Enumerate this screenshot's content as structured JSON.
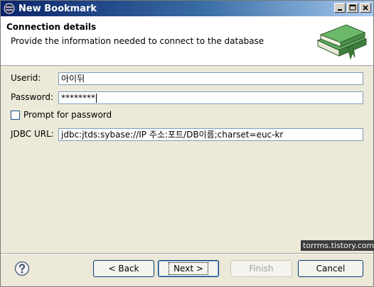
{
  "window": {
    "title": "New Bookmark"
  },
  "banner": {
    "title": "Connection details",
    "description": "Provide the information needed to connect to the database"
  },
  "form": {
    "userid_label": "Userid:",
    "userid_value": "아이뒤",
    "password_label": "Password:",
    "password_value": "********",
    "prompt_label": "Prompt for password",
    "prompt_checked": false,
    "jdbc_label": "JDBC URL:",
    "jdbc_value": "jdbc:jtds:sybase://IP 주소:포트/DB이름;charset=euc-kr"
  },
  "watermark": "torrms.tistory.com",
  "buttons": {
    "back": "< Back",
    "next": "Next >",
    "finish": "Finish",
    "cancel": "Cancel"
  },
  "colors": {
    "titlebar_start": "#0a246a",
    "titlebar_end": "#a6caf0",
    "book": "#4a8f4a"
  }
}
